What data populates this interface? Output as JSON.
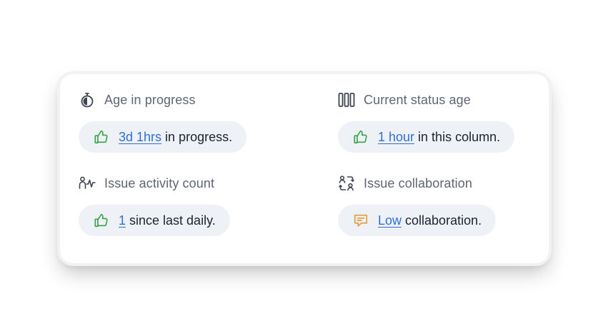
{
  "colors": {
    "positive": "#3aa34a",
    "warning": "#e59a3a",
    "link": "#2f6fd6",
    "pill_bg": "#eef2f6"
  },
  "metrics": [
    {
      "icon": "stopwatch-icon",
      "title": "Age in progress",
      "status_icon": "thumbs-up-icon",
      "value": "3d 1hrs",
      "suffix": "in progress."
    },
    {
      "icon": "columns-icon",
      "title": "Current status age",
      "status_icon": "thumbs-up-icon",
      "value": "1 hour",
      "suffix": "in this column."
    },
    {
      "icon": "activity-icon",
      "title": "Issue activity count",
      "status_icon": "thumbs-up-icon",
      "value": "1",
      "suffix": "since last daily."
    },
    {
      "icon": "collaboration-icon",
      "title": "Issue collaboration",
      "status_icon": "chat-icon",
      "value": "Low",
      "suffix": "collaboration."
    }
  ]
}
